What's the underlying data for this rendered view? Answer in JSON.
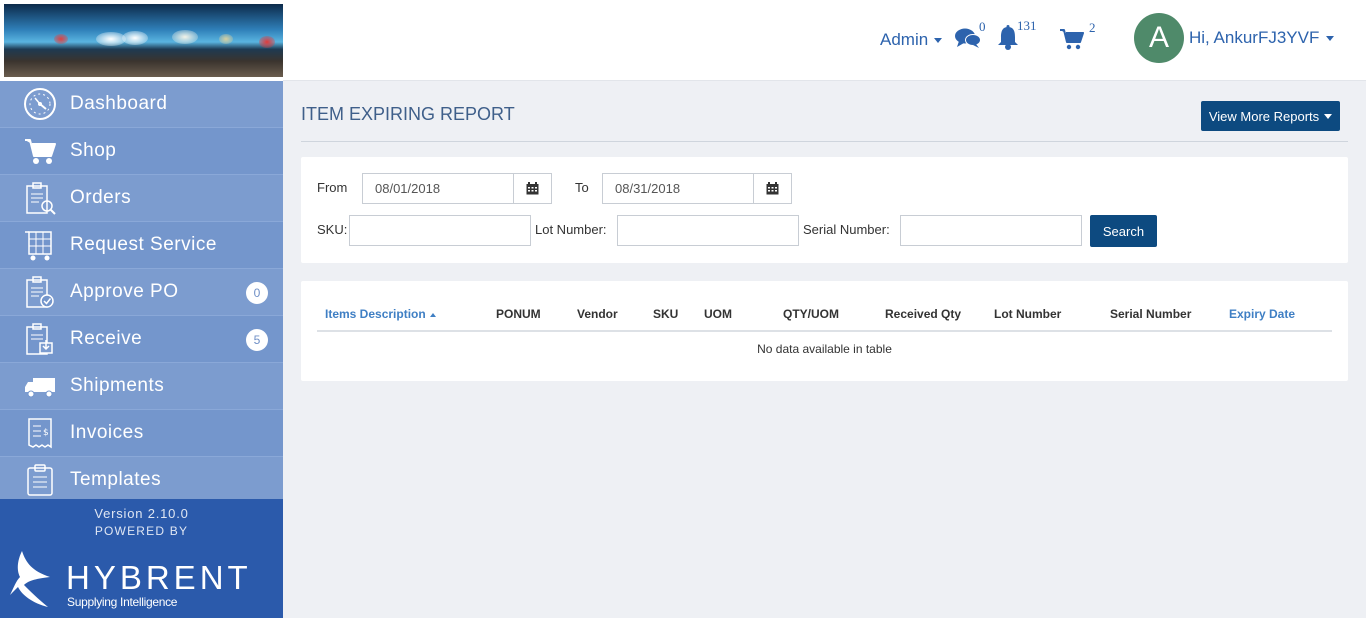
{
  "sidebar": {
    "items": [
      {
        "label": "Dashboard",
        "icon": "dashboard-icon"
      },
      {
        "label": "Shop",
        "icon": "cart-icon"
      },
      {
        "label": "Orders",
        "icon": "orders-icon"
      },
      {
        "label": "Request Service",
        "icon": "request-service-icon"
      },
      {
        "label": "Approve PO",
        "icon": "approve-po-icon",
        "badge": "0"
      },
      {
        "label": "Receive",
        "icon": "receive-icon",
        "badge": "5"
      },
      {
        "label": "Shipments",
        "icon": "truck-icon"
      },
      {
        "label": "Invoices",
        "icon": "invoice-icon"
      },
      {
        "label": "Templates",
        "icon": "templates-icon"
      }
    ],
    "version": "Version 2.10.0",
    "powered_by": "POWERED BY",
    "logo_word": "HYBRENT",
    "logo_tagline": "Supplying Intelligence"
  },
  "header": {
    "admin_label": "Admin",
    "messages_count": "0",
    "notifications_count": "131",
    "cart_count": "2",
    "avatar_letter": "A",
    "user_greeting": "Hi, AnkurFJ3YVF"
  },
  "page": {
    "title": "ITEM EXPIRING REPORT",
    "more_reports_label": "View More Reports"
  },
  "filters": {
    "from_label": "From",
    "from_value": "08/01/2018",
    "to_label": "To",
    "to_value": "08/31/2018",
    "sku_label": "SKU:",
    "lot_label": "Lot Number:",
    "serial_label": "Serial Number:",
    "search_label": "Search"
  },
  "table": {
    "columns": [
      "Items Description",
      "PONUM",
      "Vendor",
      "SKU",
      "UOM",
      "QTY/UOM",
      "Received Qty",
      "Lot Number",
      "Serial Number",
      "Expiry Date"
    ],
    "empty_message": "No data available in table"
  },
  "colors": {
    "sidebar": "#7b9bd0",
    "sidebar_footer": "#2b5aab",
    "primary_button": "#0d4a80",
    "link": "#2d63ad",
    "avatar": "#4f8a6a"
  }
}
